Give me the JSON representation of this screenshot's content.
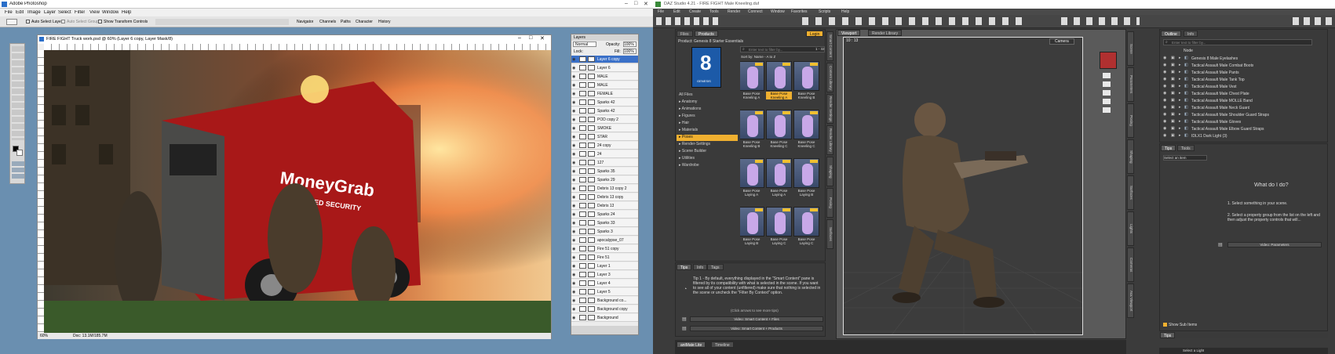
{
  "photoshop": {
    "window_title": "Adobe Photoshop",
    "menu": [
      "File",
      "Edit",
      "Image",
      "Layer",
      "Select",
      "Filter",
      "View",
      "Window",
      "Help"
    ],
    "options": {
      "auto_select": "Auto Select Layer",
      "auto_select_groups": "Auto Select Groups",
      "transform": "Show Transform Controls"
    },
    "palette_tabs": [
      "Navigator",
      "Channels",
      "Paths",
      "Character",
      "History"
    ],
    "document_title": "FIRE FIGHT Truck work.psd @ 60% (Layer 6 copy, Layer Mask/8)",
    "status": {
      "zoom": "60%",
      "doc": "Doc: 13.1M/185.7M"
    },
    "canvas_text": {
      "brand": "MoneyGrab",
      "sub": "ARMORED SECURITY"
    },
    "layers_panel": {
      "title": "Layers",
      "blend_mode": "Normal",
      "opacity_label": "Opacity:",
      "opacity": "100%",
      "lock_label": "Lock:",
      "fill_label": "Fill:",
      "fill": "100%",
      "layers": [
        {
          "name": "Layer 6 copy",
          "selected": true
        },
        {
          "name": "Layer 6"
        },
        {
          "name": "MALE"
        },
        {
          "name": "MALE"
        },
        {
          "name": "FEMALE"
        },
        {
          "name": "Sparks 42"
        },
        {
          "name": "Sparks 42"
        },
        {
          "name": "POD copy 2"
        },
        {
          "name": "SMOKE"
        },
        {
          "name": "STAR"
        },
        {
          "name": "24 copy"
        },
        {
          "name": "24"
        },
        {
          "name": "127"
        },
        {
          "name": "Sparks 35"
        },
        {
          "name": "Sparks 29"
        },
        {
          "name": "Debris 13 copy 2"
        },
        {
          "name": "Debris 13 copy"
        },
        {
          "name": "Debris 13"
        },
        {
          "name": "Sparks 24"
        },
        {
          "name": "Sparks 33"
        },
        {
          "name": "Sparks 3"
        },
        {
          "name": "apocalypse_07"
        },
        {
          "name": "Fire 51 copy"
        },
        {
          "name": "Fire 51"
        },
        {
          "name": "Layer 1"
        },
        {
          "name": "Layer 3"
        },
        {
          "name": "Layer 4"
        },
        {
          "name": "Layer 5"
        },
        {
          "name": "Background co..."
        },
        {
          "name": "Background copy"
        },
        {
          "name": "Background"
        }
      ]
    }
  },
  "daz": {
    "window_title": "DAZ Studio 4.21 - FIRE FIGHT Male Kneeling.duf",
    "menu": [
      "File",
      "Edit",
      "Create",
      "Tools",
      "Render",
      "Connect",
      "Window",
      "Favorites",
      "Scripts",
      "Help"
    ],
    "left_tabs": [
      "Files",
      "Products"
    ],
    "login": "Login",
    "product_label": "Product: Genesis 8 Starter Essentials",
    "logo_text": "8",
    "logo_sub": "GENESIS",
    "filter_placeholder": "Enter text to filter by...",
    "page_info": "1 - 32",
    "sort_label": "Sort by: Name - A to Z",
    "categories": [
      {
        "name": "All Files"
      },
      {
        "name": "▸ Anatomy"
      },
      {
        "name": "▸ Animations"
      },
      {
        "name": "▸ Figures"
      },
      {
        "name": "▸ Hair"
      },
      {
        "name": "▸ Materials"
      },
      {
        "name": "▸ Poses",
        "selected": true
      },
      {
        "name": "▸ Render-Settings"
      },
      {
        "name": "▸ Scene Builder"
      },
      {
        "name": "▸ Utilities"
      },
      {
        "name": "▸ Wardrobe"
      }
    ],
    "tiles": [
      {
        "label": "Base Pose Kneeling A"
      },
      {
        "label": "Base Pose Kneeling A",
        "selected": true
      },
      {
        "label": "Base Pose Kneeling B"
      },
      {
        "label": "Base Pose Kneeling B"
      },
      {
        "label": "Base Pose Kneeling C"
      },
      {
        "label": "Base Pose Kneeling C"
      },
      {
        "label": "Base Pose Laying A"
      },
      {
        "label": "Base Pose Laying A"
      },
      {
        "label": "Base Pose Laying B"
      },
      {
        "label": "Base Pose Laying B"
      },
      {
        "label": "Base Pose Laying C"
      },
      {
        "label": "Base Pose Laying C"
      }
    ],
    "tips_tabs": [
      "Tips",
      "Info",
      "Tags"
    ],
    "tip_text": "Tip 1 - By default, everything displayed in the \"Smart Content\" pane is filtered by its compatibility with what is selected in the scene. If you want to see all of your content (unfiltered) make sure that nothing is selected in the scene or uncheck the \"Filter By Context\" option.",
    "tip_nav": "(Click arrows to see more tips)",
    "video_buttons": [
      "Video: Smart Content + Files",
      "Video: Smart Content + Products"
    ],
    "left_vtabs": [
      "Smart Content",
      "Content Library",
      "Render Settings",
      "Render Library",
      "Shaping",
      "Posing",
      "Surfaces"
    ],
    "viewport_tabs": [
      "Viewport",
      "Render Library"
    ],
    "viewport_counter": "10 : 13",
    "camera_label": "Camera",
    "bottom_tabs": [
      "aniMate Lite",
      "Timeline"
    ],
    "right_tabs": [
      "Outline",
      "Info"
    ],
    "scene_filter_placeholder": "Enter text to filter by...",
    "scene_header": "Node",
    "scene_items": [
      "Genesis 8 Male Eyelashes",
      "Tactical Assault Male Combat Boots",
      "Tactical Assault Male Pants",
      "Tactical Assault Male Tank Top",
      "Tactical Assault Male Vest",
      "Tactical Assault Male Chest Plate",
      "Tactical Assault Male MOLLE Band",
      "Tactical Assault Male Neck Guard",
      "Tactical Assault Male Shoulder Guard Straps",
      "Tactical Assault Male Gloves",
      "Tactical Assault Male Elbow Guard Straps",
      "IDLX1 Dark Light (3)"
    ],
    "props_tabs": [
      "Tips",
      "Tools"
    ],
    "select_item": "Select an item",
    "what_title": "What do I do?",
    "what_steps": [
      "1. Select something in your scene.",
      "2. Select a property group from the list on the left and then adjust the property controls that will..."
    ],
    "video_params": "Video: Parameters",
    "show_sub": "Show Sub Items",
    "bottom_tip": "Tips",
    "right_vtabs": [
      "Scene",
      "Parameters",
      "Posing",
      "Shaping",
      "Surfaces",
      "Lights",
      "Cameras",
      "Aux Viewport"
    ],
    "select_light": "Select a Light"
  }
}
